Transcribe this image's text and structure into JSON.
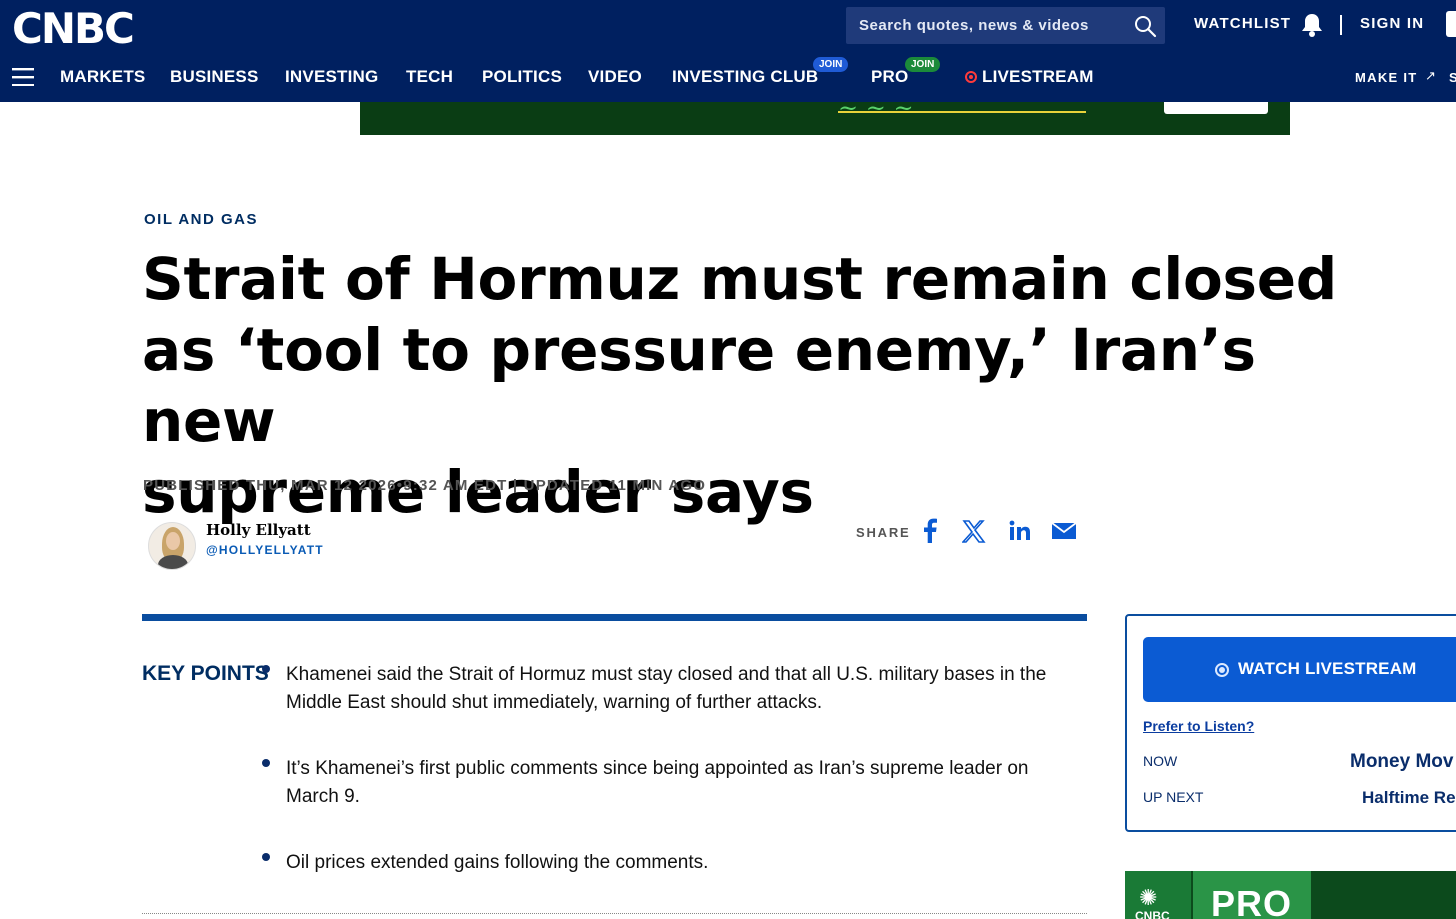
{
  "header": {
    "logo": "CNBC",
    "search_placeholder": "Search quotes, news & videos",
    "watchlist": "WATCHLIST",
    "sign_in": "SIGN IN",
    "nav": [
      {
        "label": "MARKETS"
      },
      {
        "label": "BUSINESS"
      },
      {
        "label": "INVESTING"
      },
      {
        "label": "TECH"
      },
      {
        "label": "POLITICS"
      },
      {
        "label": "VIDEO"
      },
      {
        "label": "INVESTING CLUB",
        "badge": "JOIN",
        "badge_color": "#1f5bd6"
      },
      {
        "label": "PRO",
        "badge": "JOIN",
        "badge_color": "#1b8a3a"
      },
      {
        "label": "LIVESTREAM",
        "live_color": "#ff3b3b"
      }
    ],
    "make_it": "MAKE IT",
    "nav_overflow": "S",
    "colors": {
      "bar": "#002060",
      "accent": "#0b5bd3"
    }
  },
  "article": {
    "kicker": "OIL AND GAS",
    "headline_lines": [
      "Strait of Hormuz must remain closed",
      "as ‘tool to pressure enemy,’ Iran’s new",
      "supreme leader says"
    ],
    "dateline": "PUBLISHED THU, MAR 12 2026•9:32 AM EDT | UPDATED 11 MIN AGO",
    "author": {
      "name": "Holly Ellyatt",
      "handle": "@HOLLYELLYATT"
    },
    "share_label": "SHARE",
    "share_icons": [
      "facebook-icon",
      "x-icon",
      "linkedin-icon",
      "email-icon"
    ],
    "key_points_title": "KEY POINTS",
    "key_points": [
      "Khamenei said the Strait of Hormuz must stay closed and that all U.S. military bases in the Middle East should shut immediately, warning of further attacks.",
      "It’s Khamenei’s first public comments since being appointed as Iran’s supreme leader on March 9.",
      "Oil prices extended gains following the comments."
    ]
  },
  "sidebar": {
    "watch_label": "WATCH LIVESTREAM",
    "prefer_listen": "Prefer to Listen?",
    "now_label": "NOW",
    "now_show": "Money Mov",
    "next_label": "UP NEXT",
    "next_show": "Halftime Re",
    "promo_brand": "CNBC",
    "promo_word": "PRO"
  }
}
